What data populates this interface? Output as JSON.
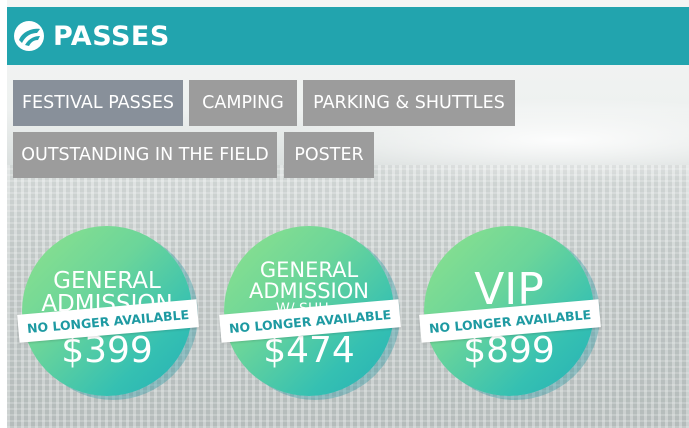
{
  "header": {
    "title": "PASSES",
    "logo_icon": "coachella-swirl-icon",
    "background_color": "#22a4ae"
  },
  "tabs": [
    {
      "label": "FESTIVAL PASSES",
      "active": true
    },
    {
      "label": "CAMPING",
      "active": false
    },
    {
      "label": "PARKING & SHUTTLES",
      "active": false
    },
    {
      "label": "OUTSTANDING IN THE FIELD",
      "active": false
    },
    {
      "label": "POSTER",
      "active": false
    }
  ],
  "passes": [
    {
      "name_lines": [
        "GENERAL",
        "ADMISSION"
      ],
      "price": "$399",
      "status": "NO LONGER AVAILABLE"
    },
    {
      "name_lines": [
        "GENERAL",
        "ADMISSION",
        "W/ SHU..."
      ],
      "price": "$474",
      "status": "NO LONGER AVAILABLE"
    },
    {
      "name_lines": [
        "VIP"
      ],
      "price": "$899",
      "status": "NO LONGER AVAILABLE"
    }
  ]
}
